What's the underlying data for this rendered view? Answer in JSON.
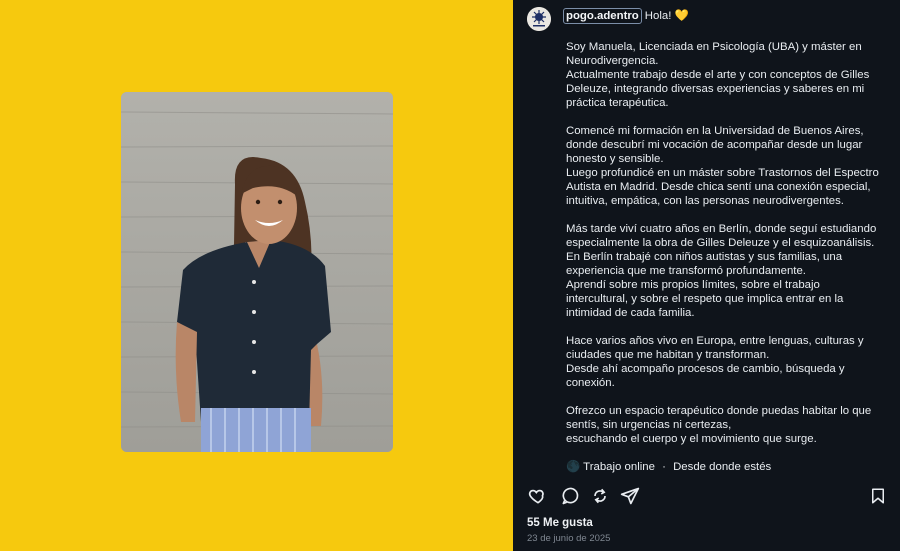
{
  "post": {
    "username": "pogo.adentro",
    "greeting": "Hola! 💛",
    "paragraphs": [
      [
        "Soy Manuela, Licenciada en Psicología (UBA) y máster en",
        "Neurodivergencia.",
        "Actualmente trabajo desde el arte y con conceptos de Gilles",
        "Deleuze, integrando diversas experiencias y saberes en mi",
        "práctica terapéutica."
      ],
      [
        "Comencé mi formación en la Universidad de Buenos Aires,",
        "donde descubrí mi vocación de acompañar desde un lugar",
        "honesto y sensible.",
        "Luego profundicé en un máster sobre Trastornos del Espectro",
        "Autista en Madrid. Desde chica sentí una conexión especial,",
        "intuitiva, empática, con las personas neurodivergentes."
      ],
      [
        "Más tarde viví cuatro años en Berlín, donde seguí estudiando",
        "especialmente la obra de Gilles Deleuze y el esquizoanálisis.",
        "En Berlín trabajé con niños autistas y sus familias, una",
        "experiencia que me transformó profundamente.",
        "Aprendí sobre mis propios límites, sobre el trabajo",
        "intercultural, y sobre el respeto que implica entrar en la",
        "intimidad de cada familia."
      ],
      [
        "Hace varios años vivo en Europa, entre lenguas, culturas y",
        "ciudades que me habitan y transforman.",
        "Desde ahí acompaño procesos de cambio, búsqueda y",
        "conexión."
      ],
      [
        "Ofrezco un espacio terapéutico donde puedas habitar lo que",
        "sentís, sin urgencias ni certezas,",
        "escuchando el cuerpo y el movimiento que surge."
      ]
    ],
    "footer_note": {
      "emoji": "🌑",
      "text": "Trabajo online",
      "separator": "·",
      "text2": "Desde donde estés"
    },
    "likes": "55 Me gusta",
    "date": "23 de junio de 2025"
  },
  "colors": {
    "background_yellow": "#f6c90e",
    "panel_bg": "#0f141b",
    "text": "#e9edf1",
    "muted": "#7f8791",
    "shirt": "#1f2a37",
    "wall": "#a7a6a1"
  },
  "icons": [
    "heart-icon",
    "comment-icon",
    "repost-icon",
    "share-icon",
    "bookmark-icon",
    "avatar-logo"
  ]
}
